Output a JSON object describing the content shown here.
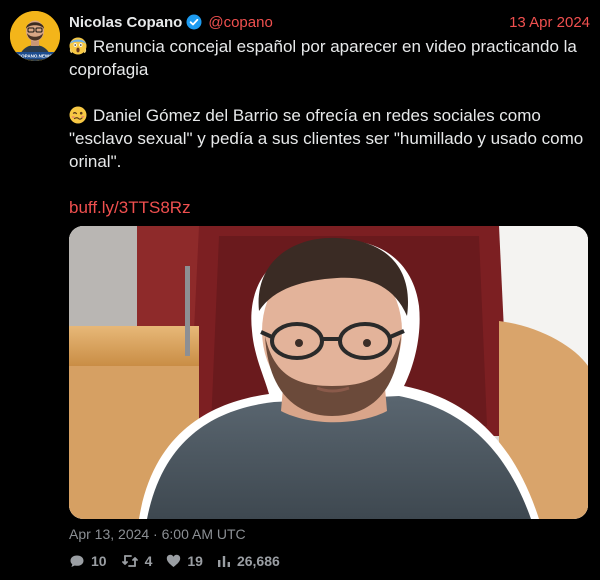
{
  "author": {
    "name": "Nicolas Copano",
    "handle": "@copano",
    "verified": true,
    "avatar_label": "COPANO.NEWS"
  },
  "date": "13 Apr 2024",
  "content": {
    "headline_emoji": "scream-emoji",
    "headline": "Renuncia concejal español por aparecer en video practicando la coprofagia",
    "detail_emoji": "woozy-face-emoji",
    "detail": "Daniel Gómez del Barrio se ofrecía en redes sociales como \"esclavo sexual\" y pedía a sus clientes ser \"humillado y usado como orinal\".",
    "link": "buff.ly/3TTS8Rz"
  },
  "timestamp": "Apr 13, 2024 · 6:00 AM UTC",
  "stats": {
    "replies": "10",
    "reposts": "4",
    "likes": "19",
    "views": "26,686"
  },
  "colors": {
    "background": "#000000",
    "accent": "#f0504f",
    "text": "#e7e9ea",
    "muted": "#8b8f94"
  }
}
